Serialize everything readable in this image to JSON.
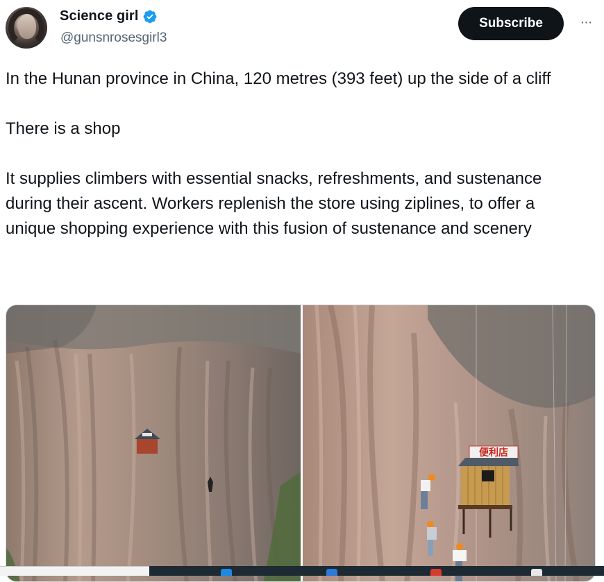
{
  "author": {
    "display_name": "Science girl",
    "handle": "@gunsnrosesgirl3",
    "verified_icon": "verified-badge-icon",
    "avatar_icon": "profile-avatar"
  },
  "actions": {
    "subscribe_label": "Subscribe",
    "more_icon": "more-options-icon",
    "more_glyph": "···"
  },
  "tweet": {
    "paragraphs": [
      "In the Hunan province in China, 120 metres (393 feet) up the side of a cliff",
      "There is a shop",
      "It supplies climbers with essential snacks, refreshments, and sustenance during their ascent. Workers replenish the store using ziplines, to offer a unique shopping experience with this fusion of sustenance and scenery"
    ]
  },
  "media": {
    "photo_count": 2,
    "shop_sign_text": "便利店"
  },
  "colors": {
    "text": "#0f1419",
    "secondary": "#536471",
    "verified": "#1d9bf0",
    "button": "#0f1419",
    "taskbar": "#1d2a33"
  }
}
